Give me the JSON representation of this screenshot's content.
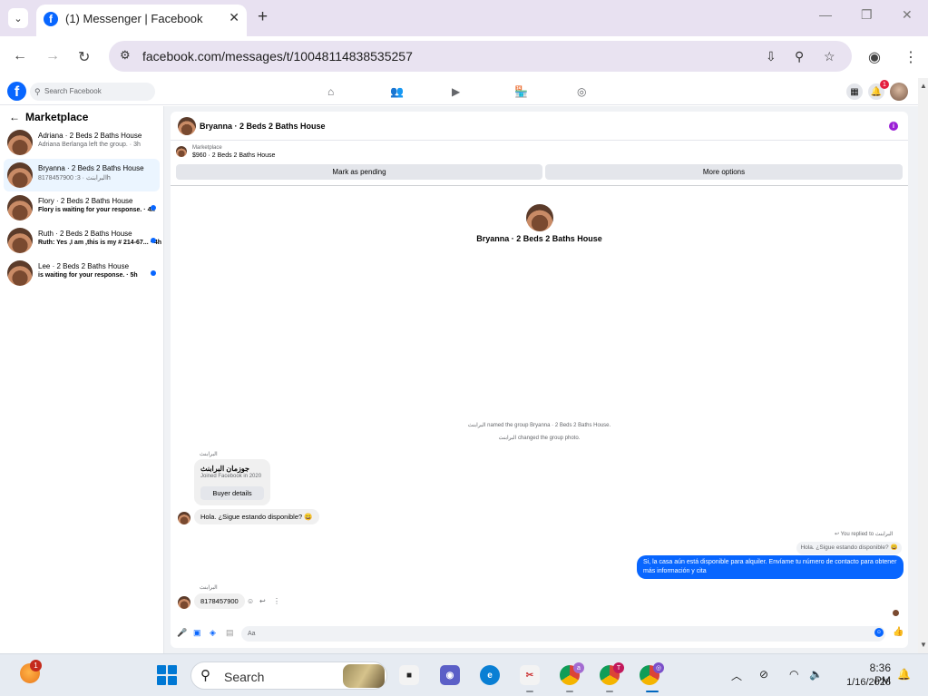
{
  "browser": {
    "tab_title": "(1) Messenger | Facebook",
    "url": "facebook.com/messages/t/10048114838535257"
  },
  "fb": {
    "search_placeholder": "Search Facebook",
    "notif_count": "1"
  },
  "sidebar": {
    "title": "Marketplace",
    "items": [
      {
        "name": "Adriana · 2 Beds 2 Baths House",
        "preview": "Adriana Berlanga left the group. · 3h",
        "unread": false,
        "active": false
      },
      {
        "name": "Bryanna · 2 Beds 2 Baths House",
        "preview": "8178457900 :البرابنث · 3h",
        "unread": false,
        "active": true
      },
      {
        "name": "Flory · 2 Beds 2 Baths House",
        "preview": "Flory is waiting for your response. · 4h",
        "unread": true,
        "active": false
      },
      {
        "name": "Ruth · 2 Beds 2 Baths House",
        "preview": "Ruth: Yes ,I am ,this is my # 214-67... · 4h",
        "unread": true,
        "active": false
      },
      {
        "name": "Lee · 2 Beds 2 Baths House",
        "preview": "is waiting for your response. · 5h",
        "unread": true,
        "active": false
      }
    ]
  },
  "chat": {
    "title": "Bryanna · 2 Beds 2 Baths House",
    "listing_label": "Marketplace",
    "listing_price": "$960 · 2 Beds 2 Baths House",
    "mark_pending": "Mark as pending",
    "more_options": "More options",
    "profile_name": "Bryanna · 2 Beds 2 Baths House",
    "sys1": "البرابنث named the group Bryanna · 2 Beds 2 Baths House.",
    "sys2": "البرابنث changed the group photo.",
    "sender": "البرابنث",
    "buyer_name": "جوزمان البرابنث",
    "buyer_joined": "Joined Facebook in 2020",
    "buyer_details": "Buyer details",
    "msg1": "Hola. ¿Sigue estando disponible? 😀",
    "replied_note": "You replied to البرابنث",
    "quoted": "Hola. ¿Sigue estando disponible? 😀",
    "reply": "Si, la casa aún está disponible para alquiler. Envíame tu número de contacto para obtener más información y cita",
    "msg2": "8178457900",
    "composer_placeholder": "Aa"
  },
  "taskbar": {
    "search": "Search",
    "weather_badge": "1",
    "time": "8:36 PM",
    "date": "1/16/2026"
  },
  "colors": {
    "fb_blue": "#0866ff",
    "chrome_frame": "#e8e1f1",
    "info_purple": "#9b1fd6"
  }
}
